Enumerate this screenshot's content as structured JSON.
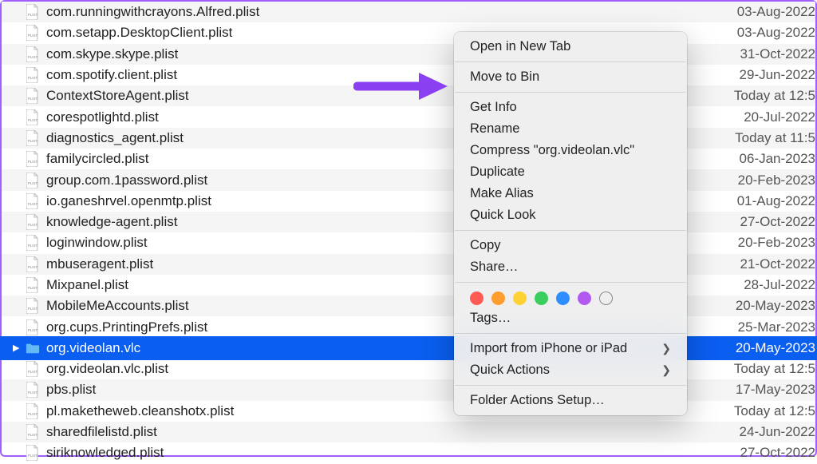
{
  "files": [
    {
      "name": "com.runningwithcrayons.Alfred.plist",
      "date": "03-Aug-2022",
      "type": "file"
    },
    {
      "name": "com.setapp.DesktopClient.plist",
      "date": "03-Aug-2022",
      "type": "file"
    },
    {
      "name": "com.skype.skype.plist",
      "date": "31-Oct-2022",
      "type": "file"
    },
    {
      "name": "com.spotify.client.plist",
      "date": "29-Jun-2022",
      "type": "file"
    },
    {
      "name": "ContextStoreAgent.plist",
      "date": "Today at 12:5",
      "type": "file"
    },
    {
      "name": "corespotlightd.plist",
      "date": "20-Jul-2022",
      "type": "file"
    },
    {
      "name": "diagnostics_agent.plist",
      "date": "Today at 11:5",
      "type": "file"
    },
    {
      "name": "familycircled.plist",
      "date": "06-Jan-2023",
      "type": "file"
    },
    {
      "name": "group.com.1password.plist",
      "date": "20-Feb-2023",
      "type": "file"
    },
    {
      "name": "io.ganeshrvel.openmtp.plist",
      "date": "01-Aug-2022",
      "type": "file"
    },
    {
      "name": "knowledge-agent.plist",
      "date": "27-Oct-2022",
      "type": "file"
    },
    {
      "name": "loginwindow.plist",
      "date": "20-Feb-2023",
      "type": "file"
    },
    {
      "name": "mbuseragent.plist",
      "date": "21-Oct-2022",
      "type": "file"
    },
    {
      "name": "Mixpanel.plist",
      "date": "28-Jul-2022",
      "type": "file"
    },
    {
      "name": "MobileMeAccounts.plist",
      "date": "20-May-2023",
      "type": "file"
    },
    {
      "name": "org.cups.PrintingPrefs.plist",
      "date": "25-Mar-2023",
      "type": "file"
    },
    {
      "name": "org.videolan.vlc",
      "date": "20-May-2023",
      "type": "folder",
      "selected": true
    },
    {
      "name": "org.videolan.vlc.plist",
      "date": "Today at 12:5",
      "type": "file"
    },
    {
      "name": "pbs.plist",
      "date": "17-May-2023",
      "type": "file"
    },
    {
      "name": "pl.maketheweb.cleanshotx.plist",
      "date": "Today at 12:5",
      "type": "file"
    },
    {
      "name": "sharedfilelistd.plist",
      "date": "24-Jun-2022",
      "type": "file"
    },
    {
      "name": "siriknowledged.plist",
      "date": "27-Oct-2022",
      "type": "file"
    }
  ],
  "menu": {
    "open_new_tab": "Open in New Tab",
    "move_to_bin": "Move to Bin",
    "get_info": "Get Info",
    "rename": "Rename",
    "compress": "Compress \"org.videolan.vlc\"",
    "duplicate": "Duplicate",
    "make_alias": "Make Alias",
    "quick_look": "Quick Look",
    "copy": "Copy",
    "share": "Share…",
    "tags": "Tags…",
    "import": "Import from iPhone or iPad",
    "quick_actions": "Quick Actions",
    "folder_actions": "Folder Actions Setup…"
  },
  "tag_colors": [
    "#ff5b52",
    "#ff9d2e",
    "#ffd233",
    "#3bcd5d",
    "#2e8eff",
    "#b25af0"
  ],
  "annotation": {
    "arrow_color": "#8a3ff0"
  }
}
